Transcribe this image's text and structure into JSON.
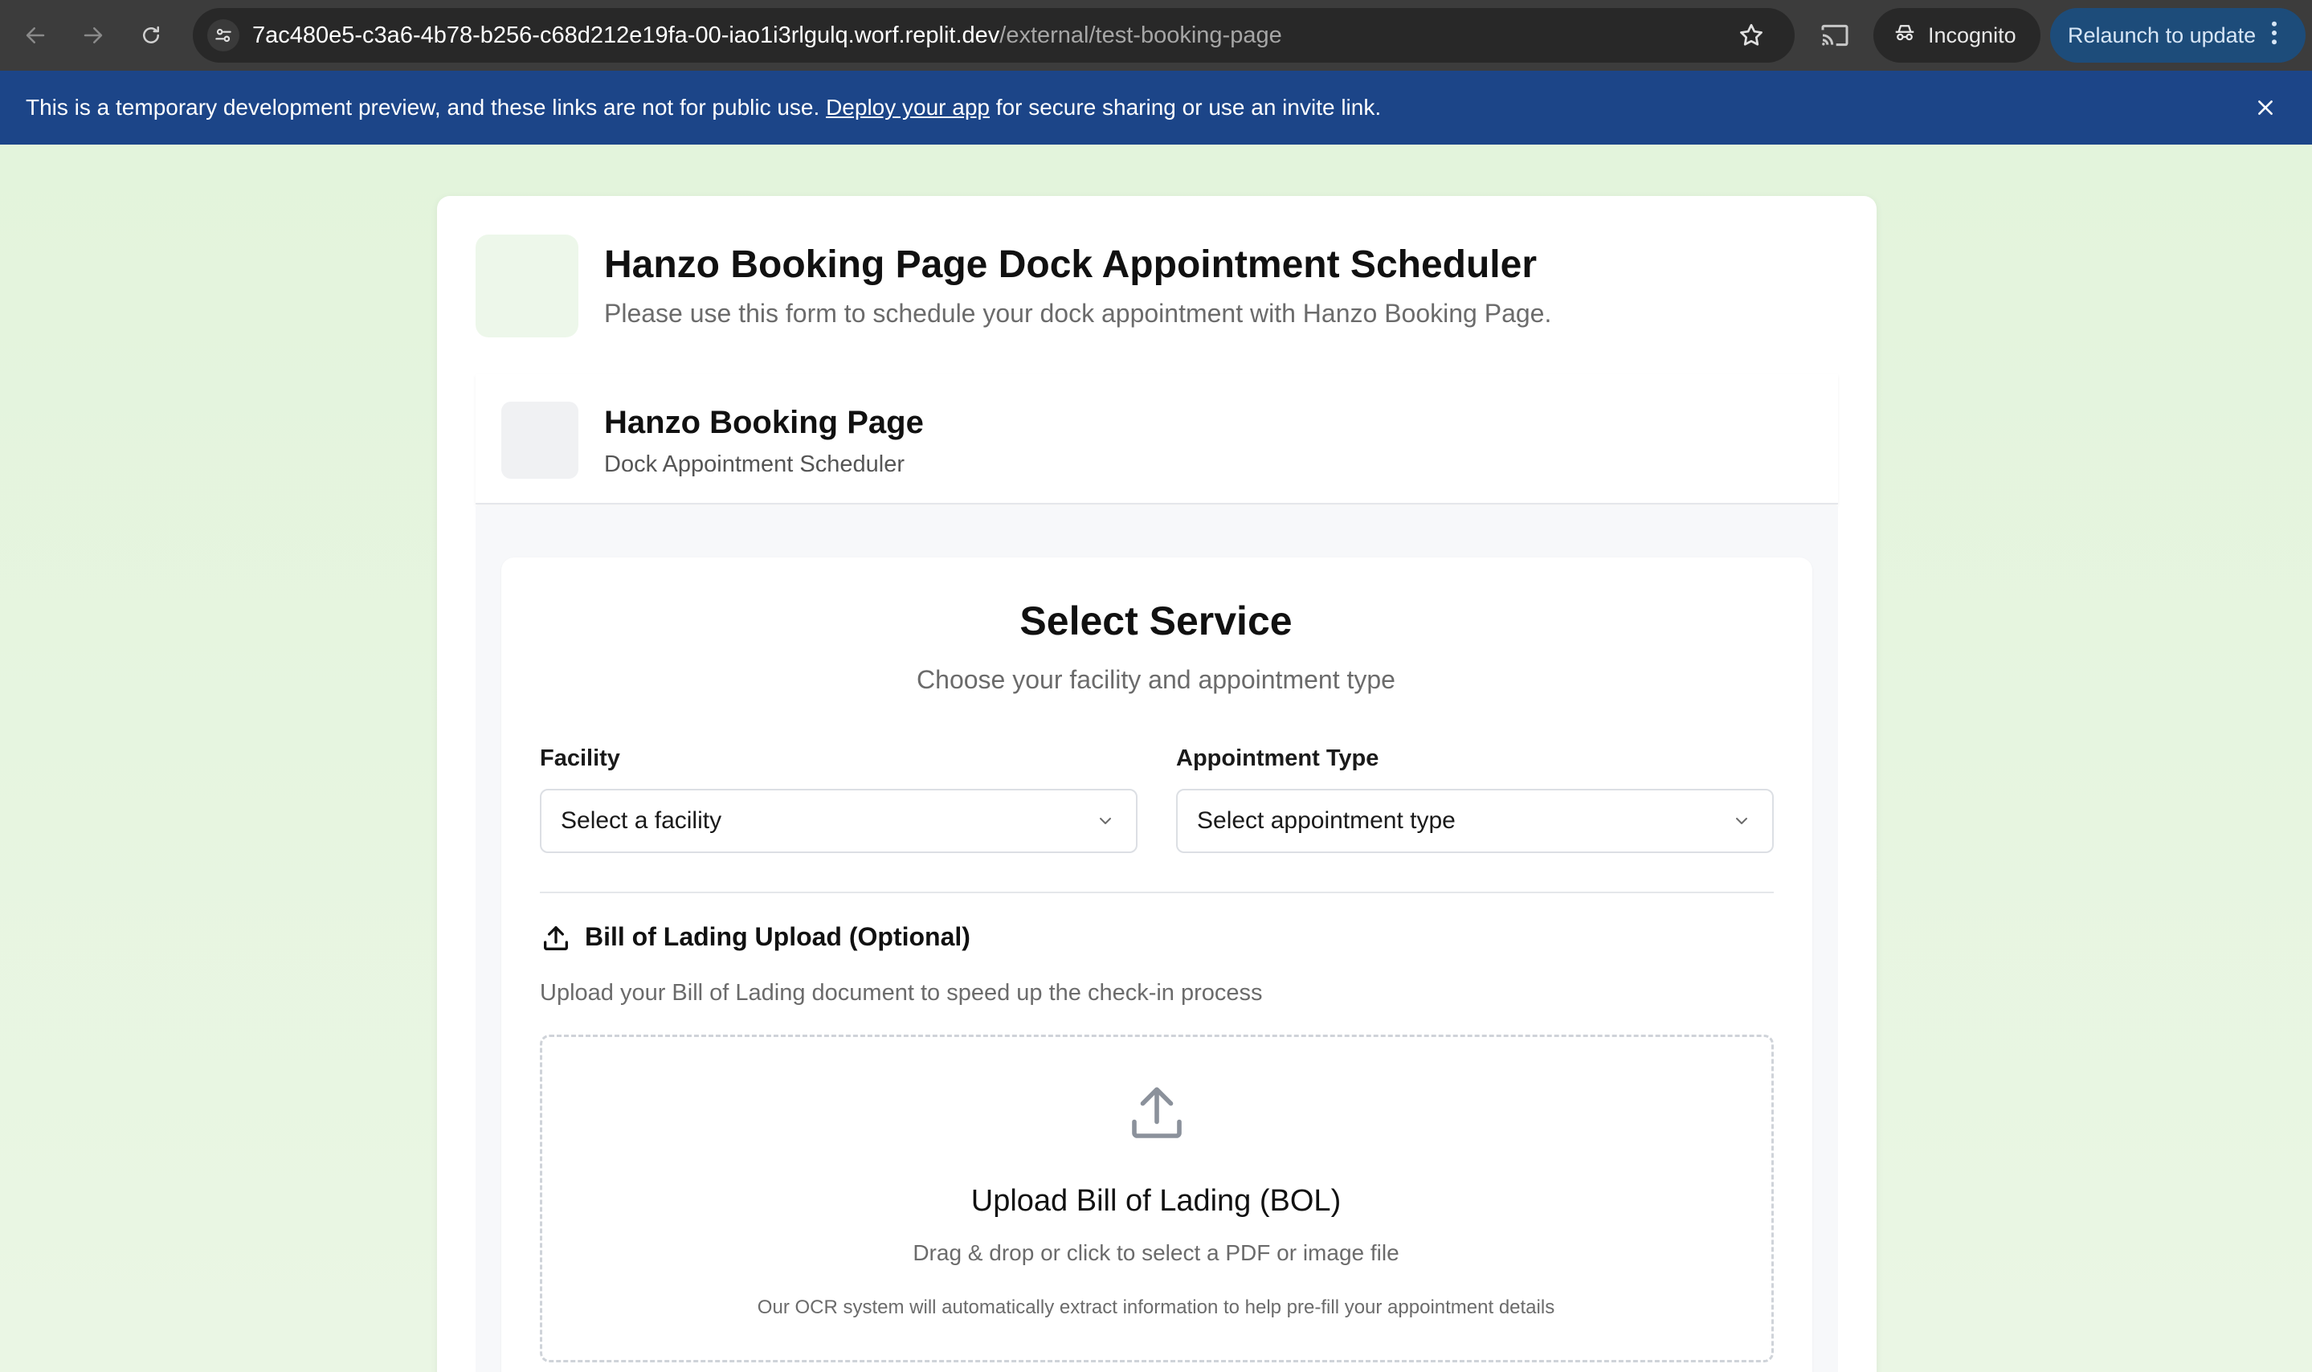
{
  "browser": {
    "url_host": "7ac480e5-c3a6-4b78-b256-c68d212e19fa-00-iao1i3rlgulq.worf.replit.dev",
    "url_path": "/external/test-booking-page",
    "incognito_label": "Incognito",
    "relaunch_label": "Relaunch to update",
    "icons": [
      "back-icon",
      "forward-icon",
      "reload-icon",
      "site-info-icon",
      "bookmark-star-icon",
      "cast-icon",
      "incognito-icon",
      "more-vert-icon"
    ]
  },
  "banner": {
    "text_before": "This is a temporary development preview, and these links are not for public use. ",
    "link": "Deploy your app",
    "text_after": " for secure sharing or use an invite link.",
    "bg_color": "#1c4588"
  },
  "header": {
    "title": "Hanzo Booking Page Dock Appointment Scheduler",
    "subtitle": "Please use this form to schedule your dock appointment with Hanzo Booking Page."
  },
  "company": {
    "name": "Hanzo Booking Page",
    "subtitle": "Dock Appointment Scheduler"
  },
  "service": {
    "title": "Select Service",
    "subtitle": "Choose your facility and appointment type",
    "facility": {
      "label": "Facility",
      "value": "Select a facility"
    },
    "appointment_type": {
      "label": "Appointment Type",
      "value": "Select appointment type"
    }
  },
  "bol": {
    "title": "Bill of Lading Upload (Optional)",
    "subtitle": "Upload your Bill of Lading document to speed up the check-in process",
    "dropzone_title": "Upload Bill of Lading (BOL)",
    "dropzone_sub": "Drag & drop or click to select a PDF or image file",
    "dropzone_note": "Our OCR system will automatically extract information to help pre-fill your appointment details"
  }
}
